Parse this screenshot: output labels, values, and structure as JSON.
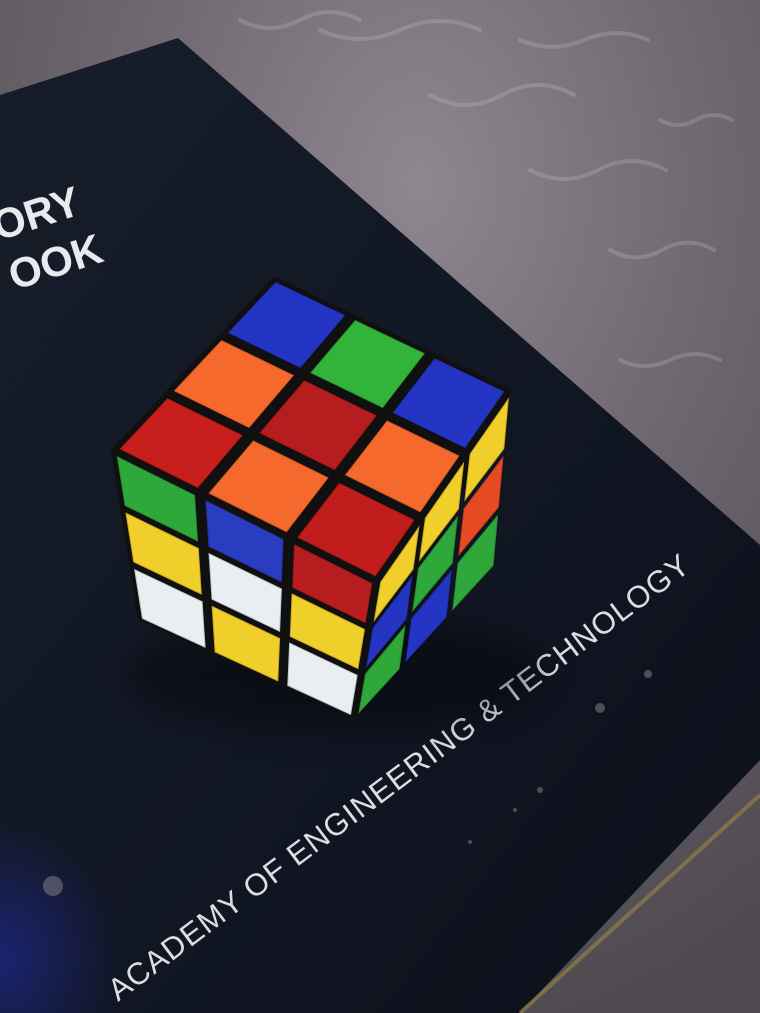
{
  "notebook": {
    "title_line_1": "ORY",
    "title_line_2": "OOK",
    "academy_text": "ACADEMY OF ENGINEERING & TECHNOLOGY"
  },
  "cube": {
    "top_face": [
      [
        "#c81f1c",
        "#f56a2c",
        "#2435c4"
      ],
      [
        "#f56a2c",
        "#b51d1f",
        "#32b43a"
      ],
      [
        "#c01d1c",
        "#f56a2c",
        "#2435c4"
      ]
    ],
    "left_face": [
      [
        "#2ea83a",
        "#2a3cc0",
        "#b81d20"
      ],
      [
        "#f0cf2a",
        "#e9eef2",
        "#f0cf2a"
      ],
      [
        "#e9eef2",
        "#f0cf2a",
        "#e9eef2"
      ]
    ],
    "right_face": [
      [
        "#f0cf2a",
        "#f0cf2a",
        "#f0cf2a"
      ],
      [
        "#2435c4",
        "#2ea83a",
        "#e64a22"
      ],
      [
        "#2ea83a",
        "#2435c4",
        "#2ea83a"
      ]
    ]
  },
  "colors": {
    "fabric": "#6f6a70",
    "notebook_cover": "#121722",
    "cube_body": "#101010"
  }
}
